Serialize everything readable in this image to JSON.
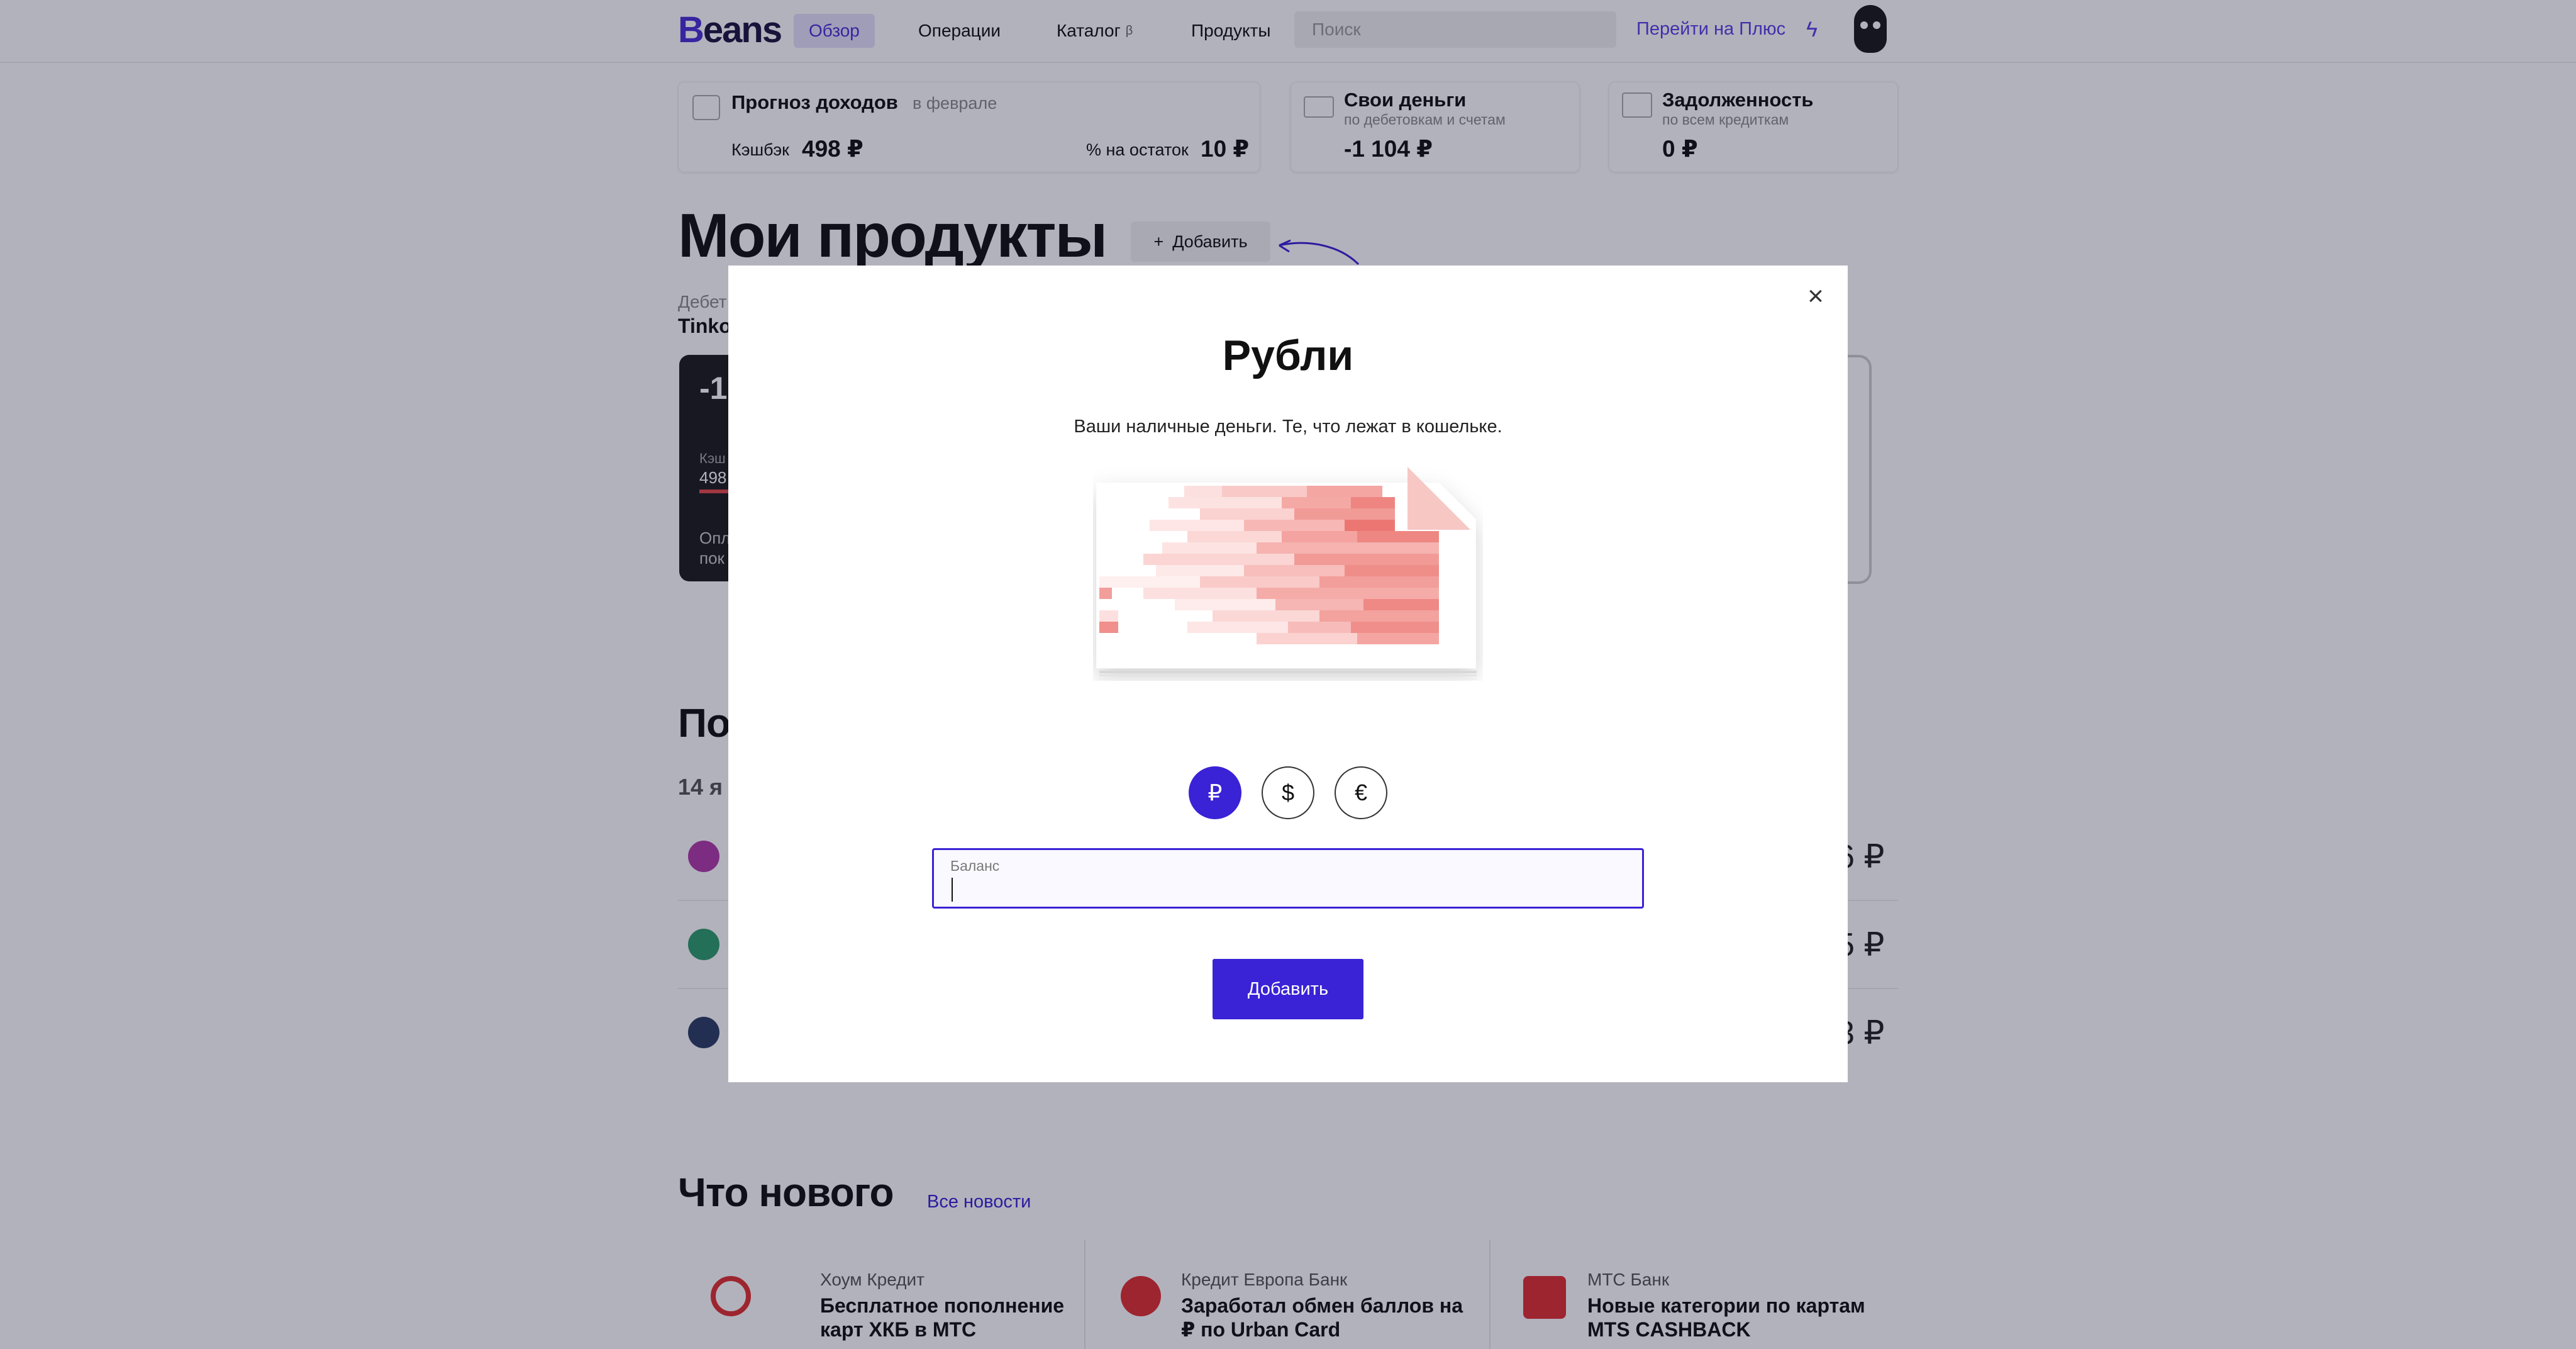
{
  "header": {
    "logo_prefix": "B",
    "logo_rest": "eans",
    "nav": [
      {
        "label": "Обзор",
        "active": true
      },
      {
        "label": "Операции",
        "active": false
      },
      {
        "label": "Каталог",
        "beta": "β",
        "active": false
      },
      {
        "label": "Продукты",
        "active": false
      }
    ],
    "search_placeholder": "Поиск",
    "plus_link": "Перейти на Плюс"
  },
  "summary": {
    "forecast": {
      "title": "Прогноз доходов",
      "subtitle": "в феврале",
      "cashback_label": "Кэшбэк",
      "cashback_value": "498 ₽",
      "interest_label": "% на остаток",
      "interest_value": "10 ₽"
    },
    "own_money": {
      "title": "Свои деньги",
      "subtitle": "по дебетовкам и счетам",
      "value": "-1 104 ₽"
    },
    "debt": {
      "title": "Задолженность",
      "subtitle": "по всем кредиткам",
      "value": "0 ₽"
    }
  },
  "products": {
    "title": "Мои продукты",
    "add_label": "Добавить",
    "debit_label_partial": "Дебет",
    "bank_partial": "Tinko",
    "card_amount_partial": "-1",
    "card_cashback_partial": "Кэш",
    "card_cashback_value_partial": "498",
    "card_note_line1": "Опл",
    "card_note_line2": "пок"
  },
  "operations": {
    "title_partial": "По",
    "date_partial": "14 я",
    "rows": [
      {
        "amount_partial": "6 ₽",
        "icon": "pin-icon",
        "color": "#b23ca8"
      },
      {
        "amount_partial": "5 ₽",
        "icon": "bag-icon",
        "color": "#2f9d6a"
      },
      {
        "amount_partial": "3 ₽",
        "icon": "film-icon",
        "color": "#2c3e63"
      }
    ]
  },
  "news": {
    "title": "Что нового",
    "all_link": "Все новости",
    "items": [
      {
        "bank": "Хоум Кредит",
        "headline": "Бесплатное пополнение карт ХКБ в МТС"
      },
      {
        "bank": "Кредит Европа Банк",
        "headline": "Заработал обмен баллов на ₽ по Urban Card"
      },
      {
        "bank": "МТС Банк",
        "headline": "Новые категории по картам MTS CASHBACK"
      }
    ]
  },
  "modal": {
    "title": "Рубли",
    "description": "Ваши наличные деньги. Те, что лежат в кошельке.",
    "currencies": [
      {
        "symbol": "₽",
        "selected": true
      },
      {
        "symbol": "$",
        "selected": false
      },
      {
        "symbol": "€",
        "selected": false
      }
    ],
    "field_label": "Баланс",
    "field_value": "",
    "submit_label": "Добавить"
  },
  "colors": {
    "accent": "#3a22d6",
    "overlay": "rgba(16,16,48,0.32)"
  }
}
